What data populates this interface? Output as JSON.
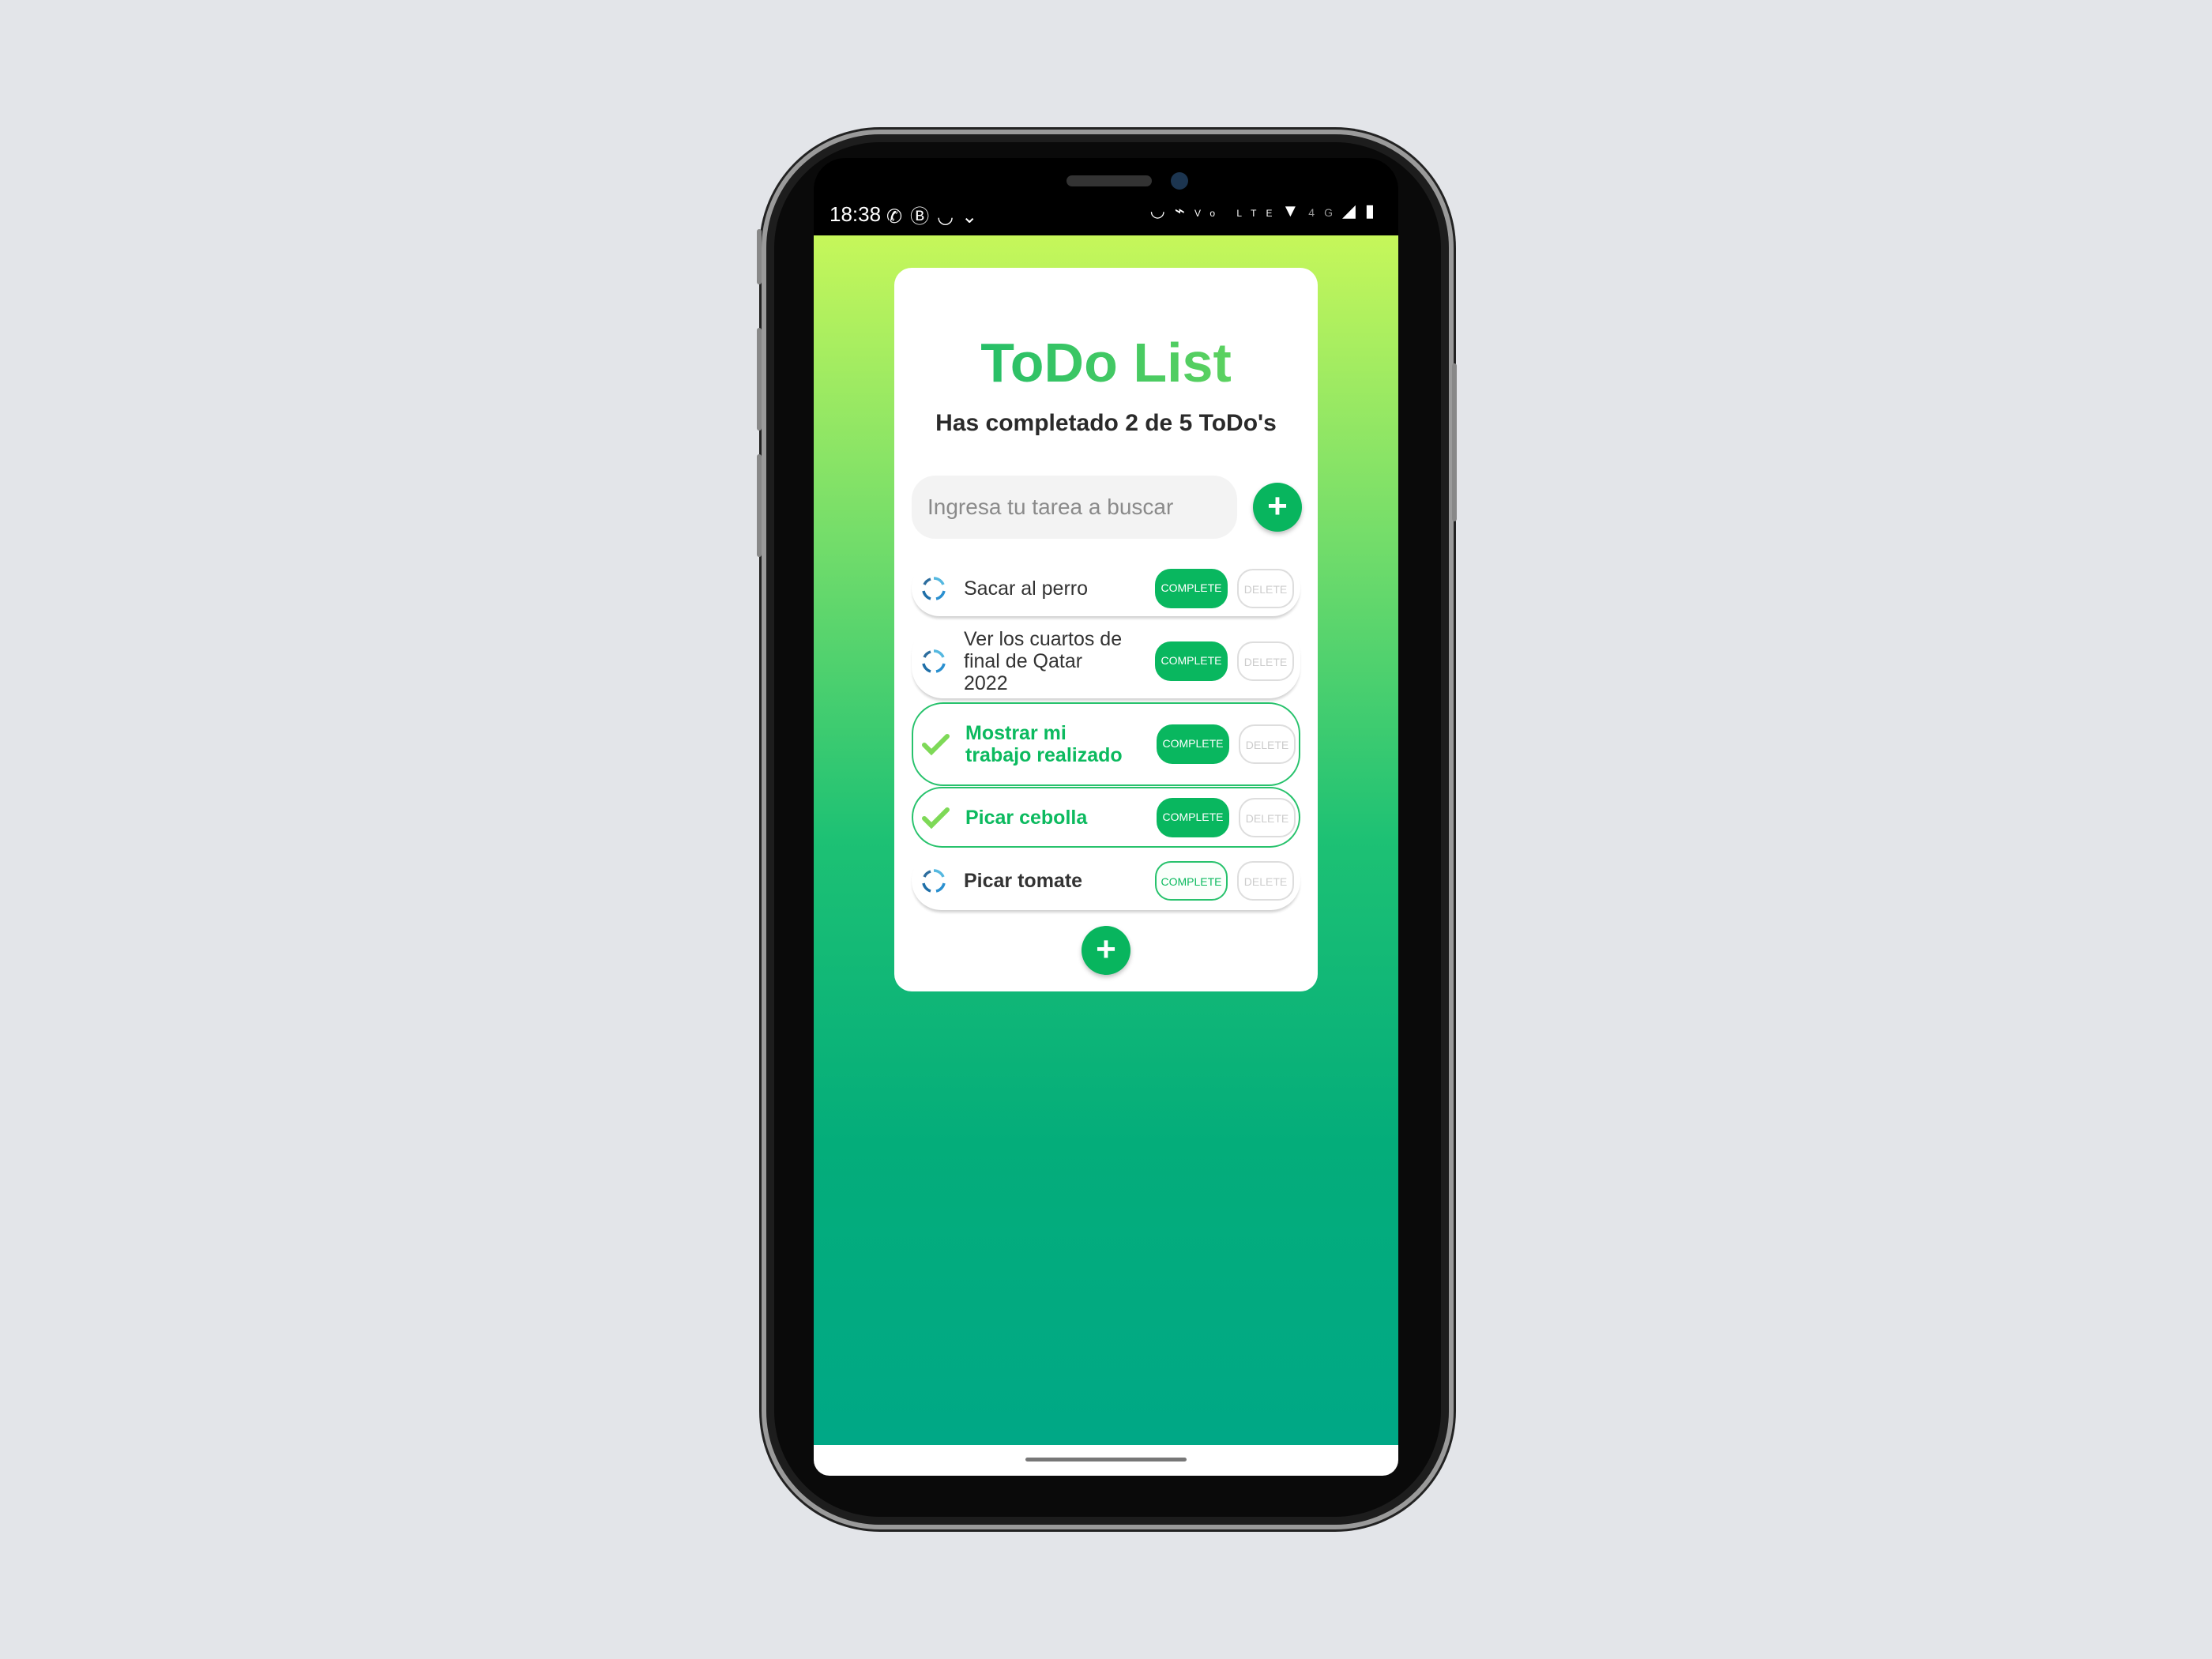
{
  "status_bar": {
    "time": "18:38",
    "left_icons": [
      "whatsapp-icon",
      "whatsapp-business-icon",
      "notification-icon",
      "download-icon"
    ],
    "right_icons": [
      "alarm-icon",
      "bluetooth-icon",
      "volte-icon",
      "wifi-icon",
      "signal-icon",
      "battery-icon"
    ],
    "volte_label": "Vo LTE",
    "network_label": "4G"
  },
  "app": {
    "title": "ToDo List",
    "subtitle": "Has completado 2 de 5 ToDo's",
    "search": {
      "placeholder": "Ingresa tu tarea a buscar",
      "value": ""
    },
    "add_label": "+",
    "todos": [
      {
        "text": "Sacar al perro",
        "completed": false
      },
      {
        "text": "Ver los cuartos de final de Qatar 2022",
        "completed": false
      },
      {
        "text": "Mostrar mi trabajo realizado",
        "completed": true
      },
      {
        "text": "Picar cebolla",
        "completed": true
      },
      {
        "text": "Picar tomate",
        "completed": false
      }
    ],
    "complete_label": "COMPLETE",
    "delete_label": "DELETE"
  },
  "colors": {
    "accent": "#09b75f",
    "gradient_top": "#c6f75a",
    "gradient_bottom": "#00a886"
  }
}
